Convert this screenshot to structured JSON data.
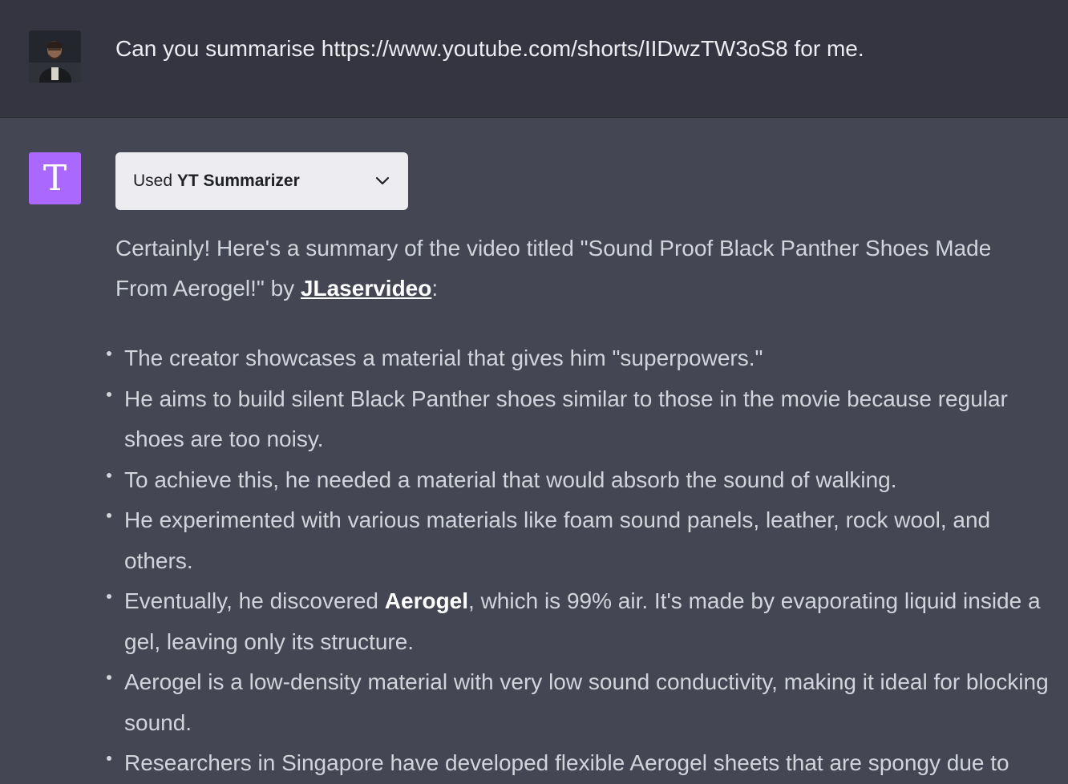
{
  "user_message": {
    "text": "Can you summarise https://www.youtube.com/shorts/IIDwzTW3oS8 for me."
  },
  "assistant": {
    "avatar_letter": "T",
    "plugin": {
      "used_label": "Used",
      "plugin_name": "YT Summarizer",
      "icon": "chevron-down-icon"
    },
    "intro": {
      "before_link": "Certainly! Here's a summary of the video titled \"Sound Proof Black Panther Shoes Made From Aerogel!\" by ",
      "link_text": "JLaservideo",
      "after_link": ":"
    },
    "bullets": [
      {
        "text": "The creator showcases a material that gives him \"superpowers.\""
      },
      {
        "text": "He aims to build silent Black Panther shoes similar to those in the movie because regular shoes are too noisy."
      },
      {
        "text": "To achieve this, he needed a material that would absorb the sound of walking."
      },
      {
        "text": "He experimented with various materials like foam sound panels, leather, rock wool, and others."
      },
      {
        "before": "Eventually, he discovered ",
        "bold": "Aerogel",
        "after": ", which is 99% air. It's made by evaporating liquid inside a gel, leaving only its structure."
      },
      {
        "text": "Aerogel is a low-density material with very low sound conductivity, making it ideal for blocking sound."
      },
      {
        "text": "Researchers in Singapore have developed flexible Aerogel sheets that are spongy due to"
      }
    ]
  },
  "colors": {
    "user_bg": "#343541",
    "assistant_bg": "#444654",
    "assistant_avatar_bg": "#ab68ff",
    "plugin_pill_bg": "#ececf1",
    "text": "#d1d5db"
  }
}
